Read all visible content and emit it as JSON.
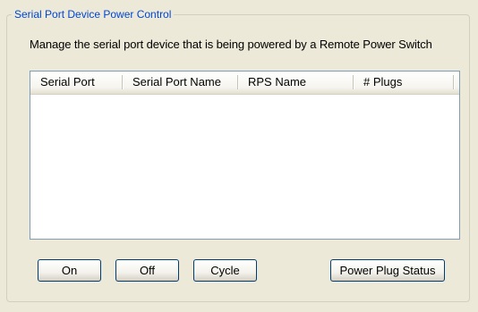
{
  "group": {
    "title": "Serial Port Device Power Control"
  },
  "description": "Manage the serial port device that is being powered by a Remote Power Switch",
  "table": {
    "columns": [
      "Serial Port",
      "Serial Port Name",
      "RPS Name",
      "# Plugs"
    ],
    "rows": []
  },
  "buttons": {
    "on": "On",
    "off": "Off",
    "cycle": "Cycle",
    "power_plug_status": "Power Plug Status"
  }
}
